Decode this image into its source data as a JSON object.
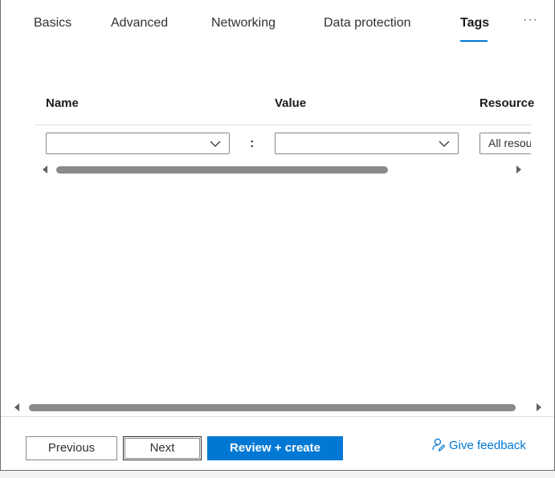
{
  "tabs": [
    {
      "label": "Basics"
    },
    {
      "label": "Advanced"
    },
    {
      "label": "Networking"
    },
    {
      "label": "Data protection"
    },
    {
      "label": "Tags",
      "active": true
    }
  ],
  "tab_more": "···",
  "table": {
    "headers": {
      "name": "Name",
      "value": "Value",
      "resource": "Resource"
    },
    "rows": [
      {
        "name": "",
        "separator": ":",
        "value": "",
        "resource": "All resources"
      }
    ]
  },
  "footer": {
    "previous": "Previous",
    "next": "Next",
    "review_create": "Review + create",
    "feedback": "Give feedback"
  },
  "colors": {
    "accent": "#0078d4"
  }
}
